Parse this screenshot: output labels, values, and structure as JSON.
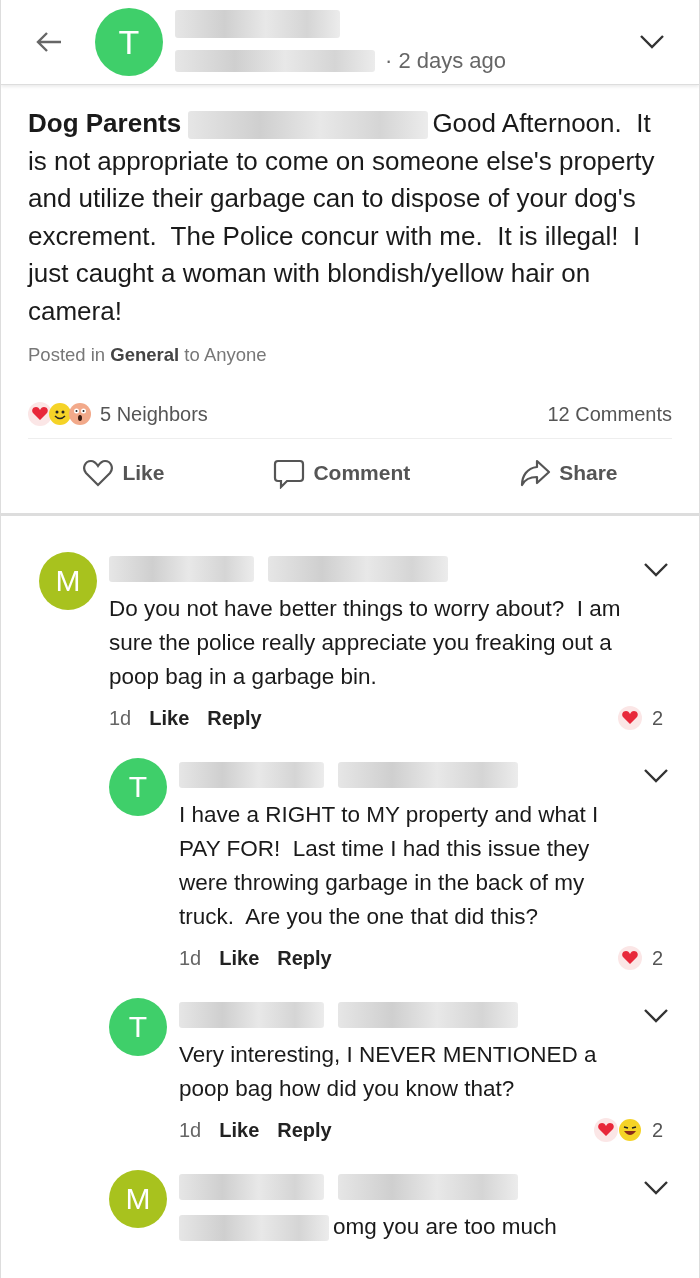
{
  "header": {
    "avatar_letter": "T",
    "color": "#3fcf6a",
    "time": "· 2 days ago"
  },
  "post": {
    "group": "Dog Parents",
    "text": "Good Afternoon.  It is not appropriate to come on someone else's property and utilize their garbage can to dispose of your dog's excrement.  The Police concur with me.  It is illegal!  I just caught a woman with blondish/yellow hair on camera!",
    "posted_in": "Posted in **General** to Anyone",
    "reactions": [
      {
        "kind": "heart"
      },
      {
        "kind": "smile"
      },
      {
        "kind": "wow"
      }
    ],
    "reaction_count": "5 Neighbors",
    "comments_count": "12 Comments",
    "actions": [
      {
        "kind": "like",
        "label": "Like"
      },
      {
        "kind": "comment",
        "label": "Comment"
      },
      {
        "kind": "share",
        "label": "Share"
      }
    ]
  },
  "comments": [
    {
      "reply": false,
      "avatar_letter": "M",
      "color": "#a8c21e",
      "redacted_prefix": false,
      "text": "Do you not have better things to worry about?  I am sure the police really appreciate you freaking out a poop bag in a garbage bin.",
      "age": "1d",
      "like": "Like",
      "reply_label": "Reply",
      "reactions": [
        {
          "kind": "heart"
        }
      ],
      "reaction_count": "2"
    },
    {
      "reply": true,
      "avatar_letter": "T",
      "color": "#3fcf6a",
      "redacted_prefix": false,
      "text": "I have a RIGHT to MY property and what I PAY FOR!  Last time I had this issue they were throwing garbage in the back of my truck.  Are you the one that did this?",
      "age": "1d",
      "like": "Like",
      "reply_label": "Reply",
      "reactions": [
        {
          "kind": "heart"
        }
      ],
      "reaction_count": "2"
    },
    {
      "reply": true,
      "avatar_letter": "T",
      "color": "#3fcf6a",
      "redacted_prefix": false,
      "text": "Very interesting, I NEVER MENTIONED a poop bag how did you know that?",
      "age": "1d",
      "like": "Like",
      "reply_label": "Reply",
      "reactions": [
        {
          "kind": "heart"
        },
        {
          "kind": "laugh"
        }
      ],
      "reaction_count": "2"
    },
    {
      "reply": true,
      "avatar_letter": "M",
      "color": "#a8c21e",
      "redacted_prefix": true,
      "text": "omg you are too much"
    }
  ]
}
